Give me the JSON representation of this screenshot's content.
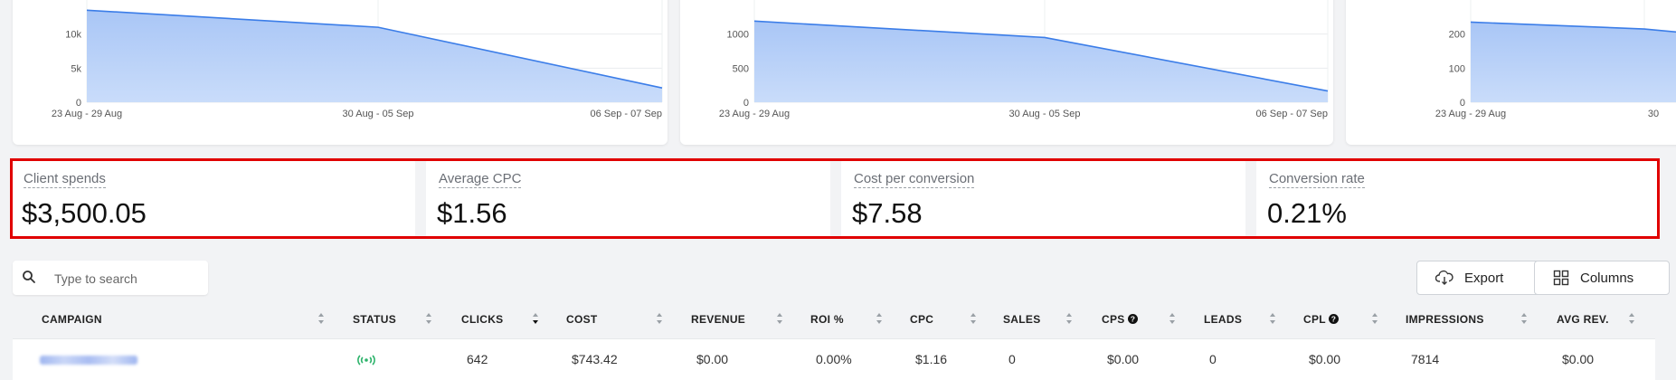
{
  "chart_data": [
    {
      "type": "area",
      "x": [
        "23 Aug - 29 Aug",
        "30 Aug - 05 Sep",
        "06 Sep - 07 Sep"
      ],
      "values": [
        13500,
        11000,
        2100
      ],
      "y_ticks": [
        "0",
        "5k",
        "10k"
      ],
      "ylim": [
        0,
        15000
      ],
      "color": "#3b7de8"
    },
    {
      "type": "area",
      "x": [
        "23 Aug - 29 Aug",
        "30 Aug - 05 Sep",
        "06 Sep - 07 Sep"
      ],
      "values": [
        1190,
        950,
        165
      ],
      "y_ticks": [
        "0",
        "500",
        "1000"
      ],
      "ylim": [
        0,
        1500
      ],
      "color": "#3b7de8"
    },
    {
      "type": "area",
      "x": [
        "23 Aug - 29 Aug",
        "30",
        ""
      ],
      "values": [
        235,
        215,
        195
      ],
      "y_ticks": [
        "0",
        "100",
        "200"
      ],
      "ylim": [
        0,
        300
      ],
      "color": "#3b7de8"
    }
  ],
  "kpis": [
    {
      "label": "Client spends",
      "value": "$3,500.05"
    },
    {
      "label": "Average CPC",
      "value": "$1.56"
    },
    {
      "label": "Cost per conversion",
      "value": "$7.58"
    },
    {
      "label": "Conversion rate",
      "value": "0.21%"
    }
  ],
  "search": {
    "placeholder": "Type to search"
  },
  "toolbar": {
    "export_label": "Export",
    "columns_label": "Columns"
  },
  "table": {
    "columns": [
      "CAMPAIGN",
      "STATUS",
      "CLICKS",
      "COST",
      "REVENUE",
      "ROI %",
      "CPC",
      "SALES",
      "CPS",
      "LEADS",
      "CPL",
      "IMPRESSIONS",
      "AVG REV."
    ],
    "rows": [
      {
        "campaign": "",
        "status_icon": "broadcast-active-icon",
        "clicks": "642",
        "cost": "$743.42",
        "revenue": "$0.00",
        "roi": "0.00%",
        "cpc": "$1.16",
        "sales": "0",
        "cps": "$0.00",
        "leads": "0",
        "cpl": "$0.00",
        "impressions": "7814",
        "avg_rev": "$0.00"
      }
    ]
  },
  "colors": {
    "accent": "#3b7de8",
    "highlight": "#e00000",
    "status_active": "#2db36b"
  }
}
